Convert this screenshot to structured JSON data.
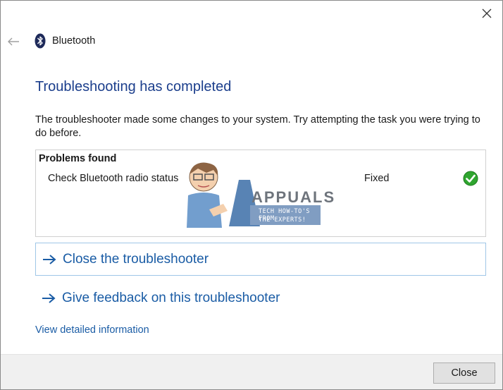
{
  "window": {
    "title": "Bluetooth"
  },
  "main": {
    "heading": "Troubleshooting has completed",
    "description": "The troubleshooter made some changes to your system. Try attempting the task you were trying to do before."
  },
  "problems": {
    "header": "Problems found",
    "items": [
      {
        "name": "Check Bluetooth radio status",
        "status": "Fixed",
        "icon": "green-check-icon"
      }
    ]
  },
  "watermark": {
    "brand": "APPUALS",
    "tagline_1": "TECH HOW-TO'S FROM",
    "tagline_2": "THE EXPERTS!"
  },
  "actions": {
    "close_troubleshooter": "Close the troubleshooter",
    "give_feedback": "Give feedback on this troubleshooter"
  },
  "links": {
    "detailed_info": "View detailed information"
  },
  "footer": {
    "close_label": "Close"
  },
  "colors": {
    "heading": "#1b3e8c",
    "link": "#1a5ca5",
    "focus_border": "#9fc6e7",
    "check_green": "#2fa52f"
  }
}
